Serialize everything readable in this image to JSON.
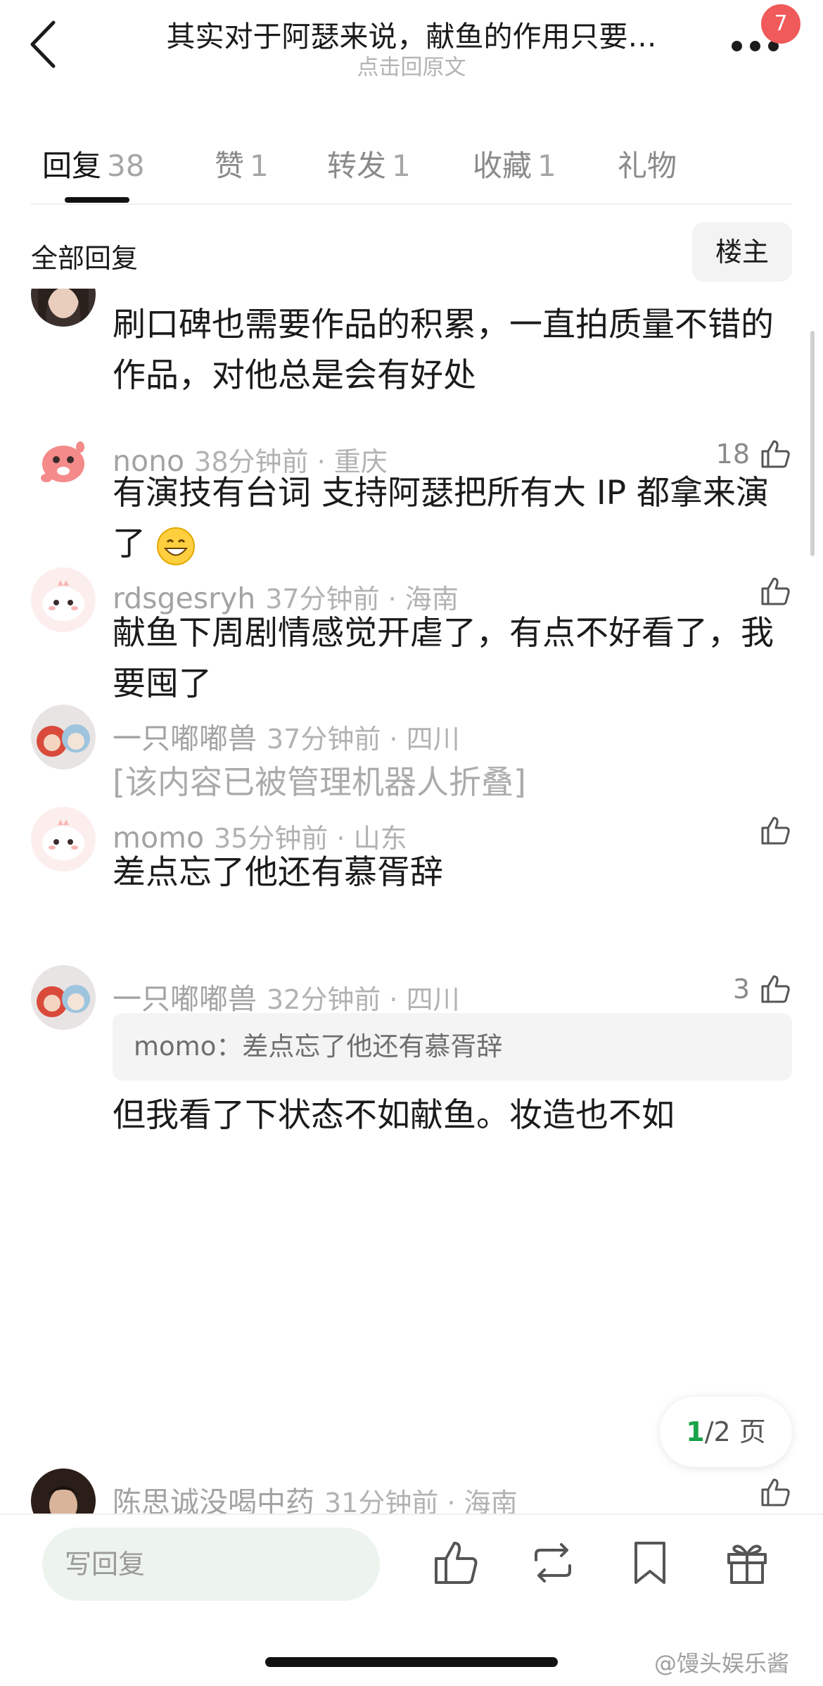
{
  "header": {
    "title": "其实对于阿瑟来说，献鱼的作用只要…",
    "subtitle": "点击回原文",
    "badge_count": "7"
  },
  "tabs": [
    {
      "label": "回复",
      "count": "38",
      "active": true
    },
    {
      "label": "赞",
      "count": "1",
      "active": false
    },
    {
      "label": "转发",
      "count": "1",
      "active": false
    },
    {
      "label": "收藏",
      "count": "1",
      "active": false
    },
    {
      "label": "礼物",
      "count": "",
      "active": false
    }
  ],
  "filter": {
    "label": "全部回复",
    "op_button": "楼主"
  },
  "comments": [
    {
      "username": "",
      "time_location": "",
      "text": "刷口碑也需要作品的积累，一直拍质量不错的作品，对他总是会有好处",
      "likes": ""
    },
    {
      "username": "nono",
      "time_location": "38分钟前 · 重庆",
      "text": "有演技有台词 支持阿瑟把所有大 IP 都拿来演了",
      "emoji": "grinning-face",
      "likes": "18"
    },
    {
      "username": "rdsgesryh",
      "time_location": "37分钟前 · 海南",
      "text": "献鱼下周剧情感觉开虐了，有点不好看了，我要囤了",
      "likes": ""
    },
    {
      "username": "一只嘟嘟兽",
      "time_location": "37分钟前 · 四川",
      "text": "[该内容已被管理机器人折叠]",
      "likes": ""
    },
    {
      "username": "momo",
      "time_location": "35分钟前 · 山东",
      "text": "差点忘了他还有慕胥辞",
      "likes": ""
    },
    {
      "username": "一只嘟嘟兽",
      "time_location": "32分钟前 · 四川",
      "quote": "momo：差点忘了他还有慕胥辞",
      "text": "但我看了下状态不如献鱼。妆造也不如",
      "likes": "3"
    },
    {
      "username": "陈思诚没喝中药",
      "time_location": "31分钟前 · 海南",
      "text": "",
      "likes": ""
    }
  ],
  "pagination": {
    "current": "1",
    "total_text": "/2 页"
  },
  "bottom_bar": {
    "reply_placeholder": "写回复"
  },
  "watermark": "@馒头娱乐酱",
  "colors": {
    "accent_green": "#1aa34a",
    "badge_red": "#f05a5a",
    "input_bg": "#edf4ee"
  }
}
